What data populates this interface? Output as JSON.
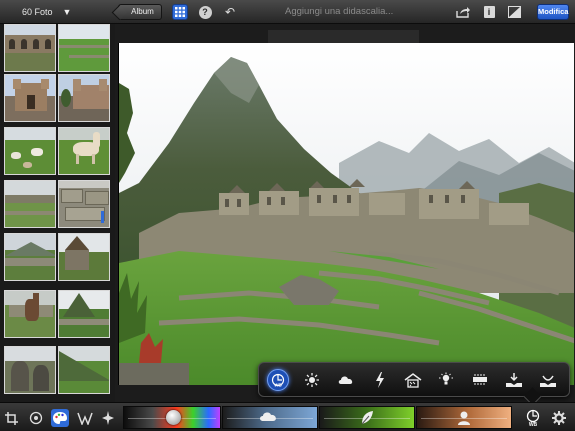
{
  "topbar": {
    "foto_count": "60 Foto",
    "album_label": "Album",
    "caption_placeholder": "Aggiungi una didascalia...",
    "modifica_label": "Modifica"
  },
  "sidebar": {
    "thumbnails": [
      {
        "subject": "courtyard-ruins"
      },
      {
        "subject": "green-terraces"
      },
      {
        "subject": "cathedral"
      },
      {
        "subject": "cathedral-square"
      },
      {
        "subject": "llamas-grazing"
      },
      {
        "subject": "alpaca"
      },
      {
        "subject": "terraced-field"
      },
      {
        "subject": "stone-wall"
      },
      {
        "subject": "mountain-ruins"
      },
      {
        "subject": "stone-hut"
      },
      {
        "subject": "llama-portrait"
      },
      {
        "subject": "huayna-picchu"
      },
      {
        "subject": "rocks"
      },
      {
        "subject": "mountain-slope"
      }
    ]
  },
  "wb_toolbar": {
    "items": [
      "auto-wb-icon",
      "sun-icon",
      "cloud-icon",
      "flash-icon",
      "shade-icon",
      "tungsten-icon",
      "fluorescent-icon",
      "eyedropper-icon",
      "face-icon"
    ],
    "auto_label": "WB"
  },
  "bottombar": {
    "tools": [
      "crop-icon",
      "rotate-icon",
      "palette-icon",
      "brush-icon",
      "effects-icon"
    ],
    "wb_label": "WB",
    "sliders": [
      "exposure-slider",
      "saturation-slider",
      "foliage-slider",
      "skin-tone-slider"
    ]
  },
  "colors": {
    "accent_blue": "#2f6bd8",
    "modifica_blue": "#3d74e6"
  }
}
